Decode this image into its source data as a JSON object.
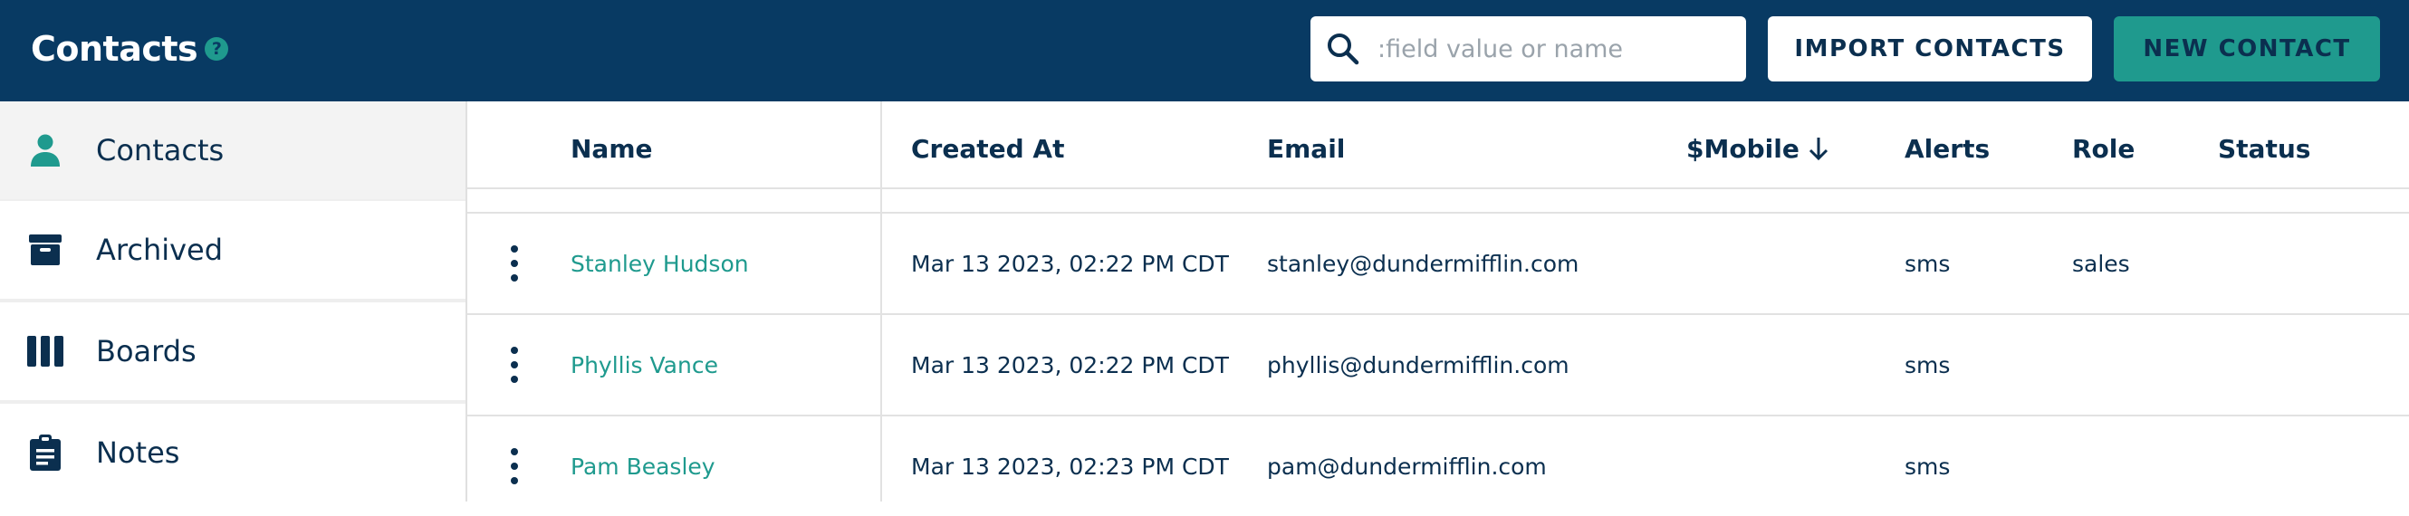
{
  "header": {
    "title": "Contacts",
    "help_icon": "?",
    "search": {
      "placeholder": ":field value or name",
      "value": ""
    },
    "import_button": "IMPORT CONTACTS",
    "new_button": "NEW CONTACT"
  },
  "sidebar": {
    "items": [
      {
        "label": "Contacts",
        "icon": "person-icon",
        "active": true
      },
      {
        "label": "Archived",
        "icon": "archive-box-icon",
        "active": false
      },
      {
        "label": "Boards",
        "icon": "columns-icon",
        "active": false
      },
      {
        "label": "Notes",
        "icon": "clipboard-icon",
        "active": false
      }
    ]
  },
  "table": {
    "columns": [
      "Name",
      "Created At",
      "Email",
      "$Mobile",
      "Alerts",
      "Role",
      "Status"
    ],
    "sort_column": "$Mobile",
    "sort_direction": "descending",
    "rows": [
      {
        "name": "Stanley Hudson",
        "created_at": "Mar 13 2023, 02:22 PM CDT",
        "email": "stanley@dundermifflin.com",
        "mobile": "",
        "alerts": "sms",
        "role": "sales",
        "status": ""
      },
      {
        "name": "Phyllis Vance",
        "created_at": "Mar 13 2023, 02:22 PM CDT",
        "email": "phyllis@dundermifflin.com",
        "mobile": "",
        "alerts": "sms",
        "role": "",
        "status": ""
      },
      {
        "name": "Pam Beasley",
        "created_at": "Mar 13 2023, 02:23 PM CDT",
        "email": "pam@dundermifflin.com",
        "mobile": "",
        "alerts": "sms",
        "role": "",
        "status": ""
      }
    ]
  },
  "colors": {
    "header_bg": "#083a63",
    "accent": "#1f9a8e",
    "text_dark": "#0b2f4f"
  }
}
